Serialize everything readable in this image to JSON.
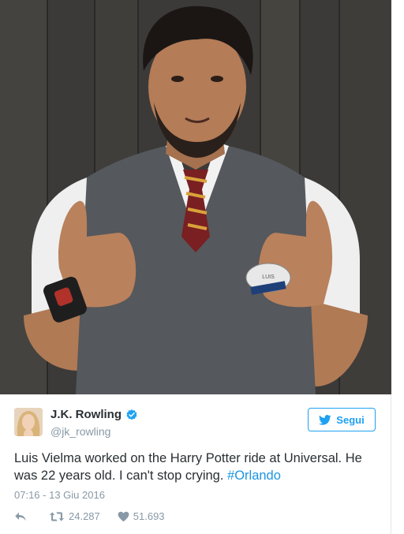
{
  "tweet": {
    "author_name": "J.K. Rowling",
    "author_handle": "@jk_rowling",
    "follow_label": "Segui",
    "text_main": "Luis Vielma worked on the Harry Potter ride at Universal. He was 22 years old. I can't stop crying. ",
    "hashtag": "#Orlando",
    "timestamp": "07:16 - 13 Giu 2016",
    "retweets": "24.287",
    "likes": "51.693"
  },
  "photo": {
    "badge_text": "LUIS"
  },
  "colors": {
    "accent": "#1da1f2",
    "hashtag": "#1b95e0",
    "muted": "#8899a6",
    "text": "#292f33"
  },
  "icons": [
    "reply-icon",
    "retweet-icon",
    "heart-icon",
    "verified-badge-icon",
    "twitter-bird-icon"
  ]
}
